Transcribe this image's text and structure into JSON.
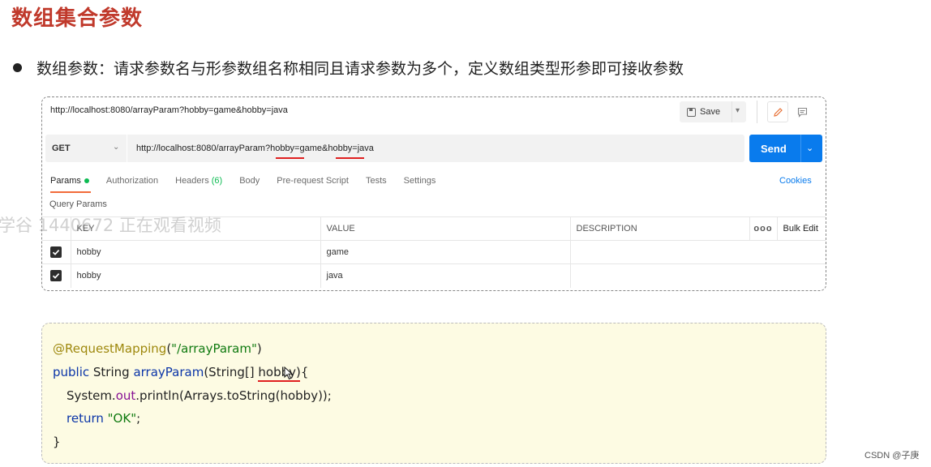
{
  "slide": {
    "title": "数组集合参数",
    "bullet": "数组参数：请求参数名与形参数组名称相同且请求参数为多个，定义数组类型形参即可接收参数",
    "watermark": "学谷 1440672 正在观看视频",
    "footer": "CSDN @子庚"
  },
  "postman": {
    "tab_url": "http://localhost:8080/arrayParam?hobby=game&hobby=java",
    "save_label": "Save",
    "method": "GET",
    "request_url": "http://localhost:8080/arrayParam?hobby=game&hobby=java",
    "send_label": "Send",
    "tabs": {
      "params": "Params",
      "authorization": "Authorization",
      "headers": "Headers",
      "headers_count": "(6)",
      "body": "Body",
      "prerequest": "Pre-request Script",
      "tests": "Tests",
      "settings": "Settings"
    },
    "cookies": "Cookies",
    "query_params_label": "Query Params",
    "columns": {
      "key": "KEY",
      "value": "VALUE",
      "description": "DESCRIPTION",
      "more": "ooo",
      "bulk_edit": "Bulk Edit"
    },
    "rows": [
      {
        "key": "hobby",
        "value": "game",
        "description": ""
      },
      {
        "key": "hobby",
        "value": "java",
        "description": ""
      }
    ]
  },
  "code": {
    "annotation": "@RequestMapping",
    "paren_open": "(",
    "mapping_path": "\"/arrayParam\"",
    "paren_close": ")",
    "kw_public": "public",
    "type_string": " String ",
    "method_name": "arrayParam",
    "params": "(String[] hobby){",
    "line3_a": "System.",
    "line3_field": "out",
    "line3_b": ".println(Arrays.toString(hobby));",
    "kw_return": "return",
    "return_value": "\"OK\"",
    "semicolon": ";",
    "close_brace": "}"
  }
}
